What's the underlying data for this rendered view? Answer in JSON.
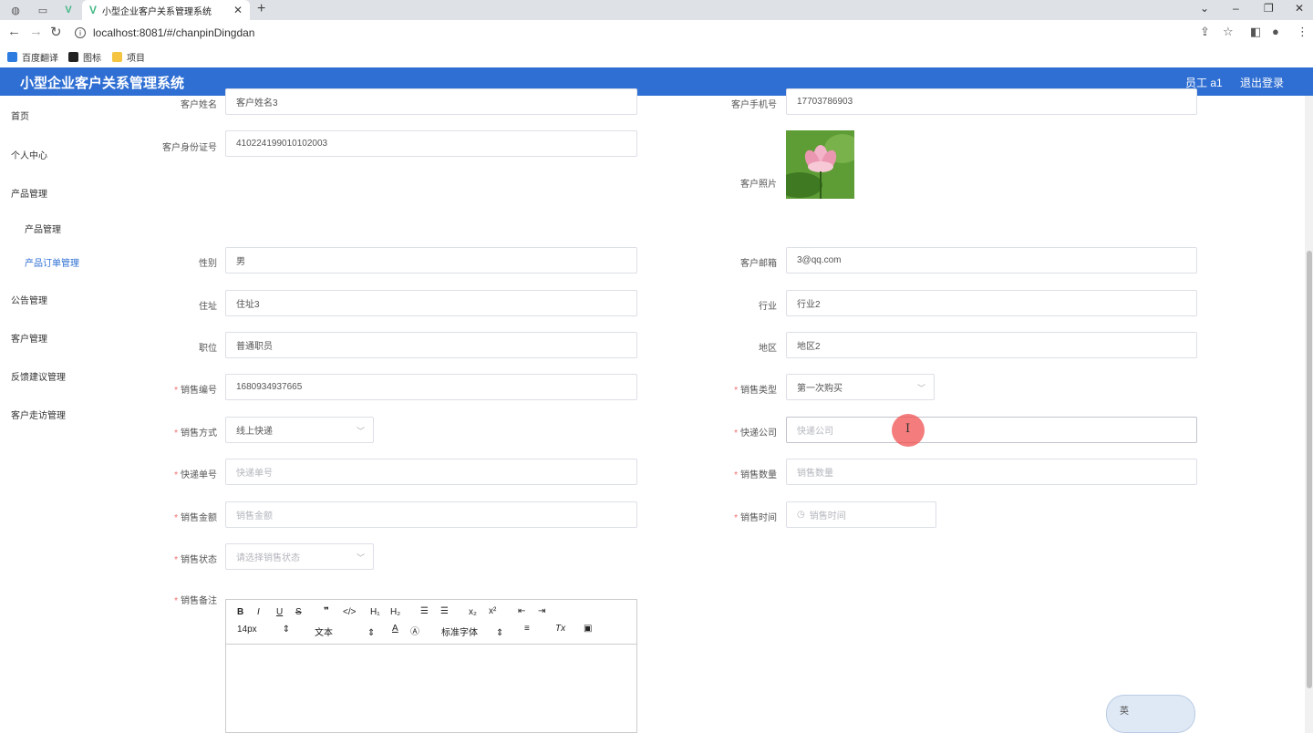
{
  "browser": {
    "tab_title": "小型企业客户关系管理系统",
    "url": "localhost:8081/#/chanpinDingdan",
    "bookmarks": [
      "百度翻译",
      "图标",
      "项目"
    ]
  },
  "app": {
    "title": "小型企业客户关系管理系统",
    "user": "员工 a1",
    "logout": "退出登录"
  },
  "sidebar": {
    "items": [
      "首页",
      "个人中心",
      "产品管理",
      "产品管理",
      "产品订单管理",
      "公告管理",
      "客户管理",
      "反馈建议管理",
      "客户走访管理"
    ]
  },
  "form": {
    "customer_name": {
      "label": "客户姓名",
      "value": "客户姓名3"
    },
    "customer_phone": {
      "label": "客户手机号",
      "value": "17703786903"
    },
    "customer_id": {
      "label": "客户身份证号",
      "value": "410224199010102003"
    },
    "customer_photo": {
      "label": "客户照片"
    },
    "gender": {
      "label": "性别",
      "value": "男"
    },
    "email": {
      "label": "客户邮箱",
      "value": "3@qq.com"
    },
    "address": {
      "label": "住址",
      "value": "住址3"
    },
    "industry": {
      "label": "行业",
      "value": "行业2"
    },
    "position": {
      "label": "职位",
      "value": "普通职员"
    },
    "region": {
      "label": "地区",
      "value": "地区2"
    },
    "sale_no": {
      "label": "销售编号",
      "value": "1680934937665"
    },
    "sale_type": {
      "label": "销售类型",
      "value": "第一次购买"
    },
    "sale_method": {
      "label": "销售方式",
      "value": "线上快递"
    },
    "express_company": {
      "label": "快递公司",
      "placeholder": "快递公司"
    },
    "express_no": {
      "label": "快递单号",
      "placeholder": "快递单号"
    },
    "sale_qty": {
      "label": "销售数量",
      "placeholder": "销售数量"
    },
    "sale_amount": {
      "label": "销售金额",
      "placeholder": "销售金额"
    },
    "sale_time": {
      "label": "销售时间",
      "placeholder": "销售时间"
    },
    "sale_status": {
      "label": "销售状态",
      "placeholder": "请选择销售状态"
    },
    "sale_note": {
      "label": "销售备注"
    }
  },
  "editor": {
    "font_size": "14px",
    "block_type": "文本",
    "font_family": "标准字体"
  },
  "ime": {
    "label": "英"
  }
}
